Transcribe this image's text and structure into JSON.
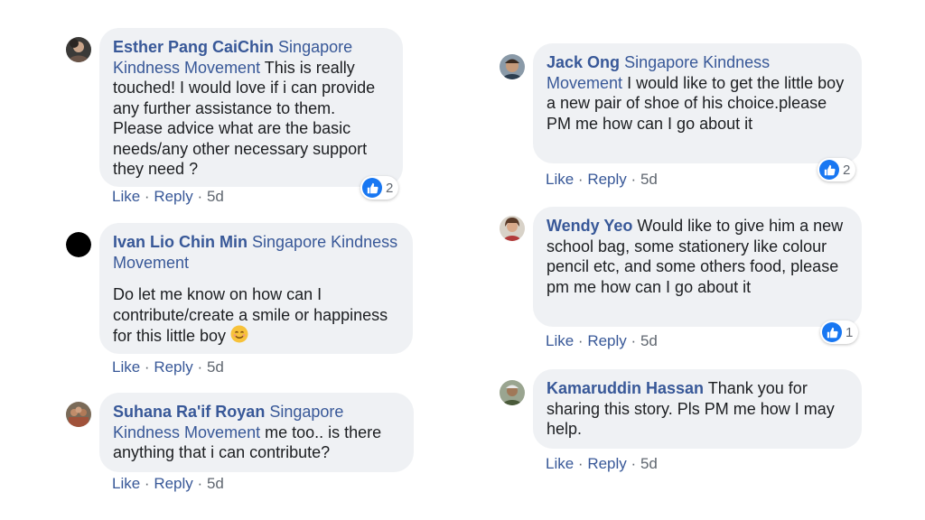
{
  "actions": {
    "like": "Like",
    "reply": "Reply",
    "separator": "·",
    "time": "5d"
  },
  "comments": [
    {
      "author": "Esther Pang CaiChin",
      "page_tag": "Singapore Kindness Movement",
      "text": "This is really touched! I would love if i can provide any further assistance to them. Please advice what are the basic needs/any other necessary support they need ?",
      "reactions": "2"
    },
    {
      "author": "Ivan Lio Chin Min",
      "page_tag": "Singapore Kindness Movement",
      "text": "Do let me know on how can I contribute/create a smile or happiness for this little boy",
      "emoji": "smiling-face-emoji"
    },
    {
      "author": "Suhana Ra'if Royan",
      "page_tag": "Singapore Kindness Movement",
      "text": "me too.. is there anything that i can contribute?"
    },
    {
      "author": "Jack Ong",
      "page_tag": "Singapore Kindness Movement",
      "text": "I would like to get the little boy a new pair of shoe of his choice.please PM me how can I go about it",
      "reactions": "2"
    },
    {
      "author": "Wendy Yeo",
      "text": "Would like to give him a new school bag, some stationery like colour pencil etc, and some others food, please pm me how can I go about it",
      "reactions": "1"
    },
    {
      "author": "Kamaruddin Hassan",
      "text": "Thank you for sharing this story. Pls PM me how I may help."
    }
  ],
  "colors": {
    "link": "#385898",
    "bubble": "#eff1f4",
    "like_blue": "#1877f2",
    "meta": "#606770"
  }
}
